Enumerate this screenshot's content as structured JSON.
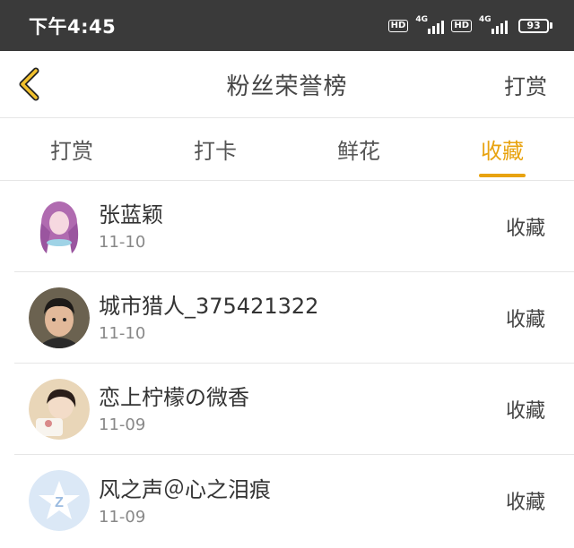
{
  "status_bar": {
    "time": "下午4:45",
    "hd_label": "HD",
    "network_label": "4G",
    "battery": "93"
  },
  "nav": {
    "title": "粉丝荣誉榜",
    "action": "打赏"
  },
  "tabs": [
    {
      "label": "打赏"
    },
    {
      "label": "打卡"
    },
    {
      "label": "鲜花"
    },
    {
      "label": "收藏"
    }
  ],
  "active_tab": "收藏",
  "accent_color": "#e8a310",
  "rows": [
    {
      "name": "张蓝颖",
      "date": "11-10",
      "type": "收藏",
      "avatar": "anime-girl-avatar"
    },
    {
      "name": "城市猎人_375421322",
      "date": "11-10",
      "type": "收藏",
      "avatar": "photo-avatar"
    },
    {
      "name": "恋上柠檬の微香",
      "date": "11-09",
      "type": "收藏",
      "avatar": "photo-avatar"
    },
    {
      "name": "风之声＠心之泪痕",
      "date": "11-09",
      "type": "收藏",
      "avatar": "default-qq-avatar"
    }
  ]
}
